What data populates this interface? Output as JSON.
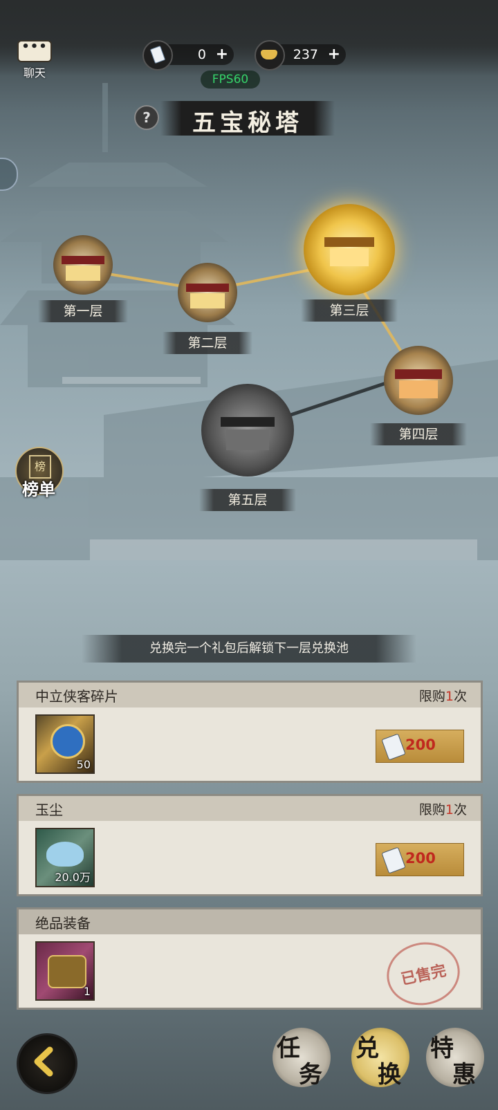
{
  "topbar": {
    "chat_label": "聊天",
    "chat_dots": "•••",
    "tickets": {
      "icon": "ticket-icon",
      "value": "0",
      "plus": "+"
    },
    "gold": {
      "icon": "gold-ingot-icon",
      "value": "237",
      "plus": "+"
    },
    "fps": "FPS60"
  },
  "header": {
    "help": "?",
    "title": "五宝秘塔"
  },
  "floors": [
    {
      "label": "第一层",
      "state": "unlocked"
    },
    {
      "label": "第二层",
      "state": "unlocked"
    },
    {
      "label": "第三层",
      "state": "current"
    },
    {
      "label": "第四层",
      "state": "unlocked"
    },
    {
      "label": "第五层",
      "state": "locked"
    }
  ],
  "rank_button": {
    "label": "榜单",
    "badge": "榜"
  },
  "hint": "兑换完一个礼包后解锁下一层兑换池",
  "items": [
    {
      "name": "中立侠客碎片",
      "limit_prefix": "限购",
      "limit_num": "1",
      "limit_suffix": "次",
      "qty": "50",
      "price": "200",
      "sold_out": false,
      "icon": "hero-fragment-icon"
    },
    {
      "name": "玉尘",
      "limit_prefix": "限购",
      "limit_num": "1",
      "limit_suffix": "次",
      "qty": "20.0万",
      "price": "200",
      "sold_out": false,
      "icon": "jade-dust-icon"
    },
    {
      "name": "绝品装备",
      "qty": "1",
      "sold_out": true,
      "sold_label": "已售完",
      "icon": "equipment-chest-icon"
    }
  ],
  "bottom_nav": {
    "task": [
      "任",
      "务"
    ],
    "exchange": [
      "兑",
      "换"
    ],
    "special": [
      "特",
      "惠"
    ],
    "active": "exchange"
  },
  "colors": {
    "accent_gold": "#d6ae5e",
    "price_red": "#c0281e",
    "fps_green": "#36d46a"
  }
}
